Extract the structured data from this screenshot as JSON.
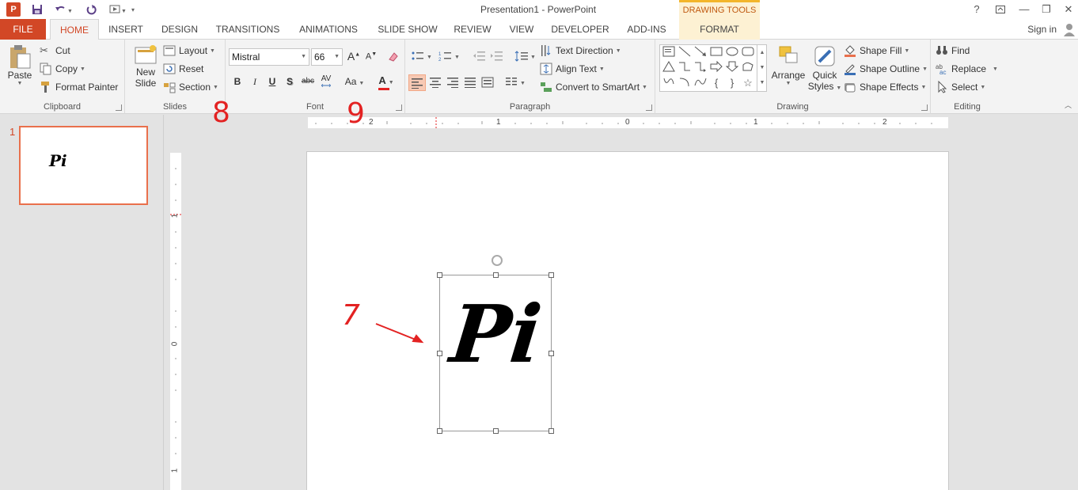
{
  "window": {
    "title": "Presentation1 - PowerPoint",
    "contextual_header": "DRAWING TOOLS",
    "help": "?",
    "minimize": "—",
    "restore": "❐",
    "close": "✕"
  },
  "tabs": {
    "file": "FILE",
    "items": [
      "HOME",
      "INSERT",
      "DESIGN",
      "TRANSITIONS",
      "ANIMATIONS",
      "SLIDE SHOW",
      "REVIEW",
      "VIEW",
      "DEVELOPER",
      "ADD-INS"
    ],
    "format": "FORMAT",
    "signin": "Sign in"
  },
  "clipboard": {
    "paste": "Paste",
    "cut": "Cut",
    "copy": "Copy",
    "format_painter": "Format Painter",
    "label": "Clipboard"
  },
  "slides": {
    "new_slide_1": "New",
    "new_slide_2": "Slide",
    "layout": "Layout",
    "reset": "Reset",
    "section": "Section",
    "label": "Slides"
  },
  "font": {
    "name": "Mistral",
    "size": "66",
    "bold": "B",
    "italic": "I",
    "underline": "U",
    "shadow": "S",
    "strike": "abc",
    "spacing": "AV",
    "case": "Aa",
    "color_letter": "A",
    "grow": "A",
    "shrink": "A",
    "label": "Font"
  },
  "paragraph": {
    "text_direction": "Text Direction",
    "align_text": "Align Text",
    "convert_smartart": "Convert to SmartArt",
    "label": "Paragraph"
  },
  "drawing": {
    "arrange": "Arrange",
    "quick_styles_1": "Quick",
    "quick_styles_2": "Styles",
    "shape_fill": "Shape Fill",
    "shape_outline": "Shape Outline",
    "shape_effects": "Shape Effects",
    "label": "Drawing"
  },
  "editing": {
    "find": "Find",
    "replace": "Replace",
    "select": "Select",
    "label": "Editing"
  },
  "ruler": {
    "h": [
      "2",
      "1",
      "0",
      "1",
      "2"
    ],
    "v": [
      "1",
      "0",
      "1"
    ]
  },
  "thumbnail": {
    "number": "1",
    "text": "Pi"
  },
  "slide": {
    "text": "Pi"
  },
  "annotations": {
    "seven": "7",
    "eight": "8",
    "nine": "9"
  },
  "colors": {
    "accent": "#d24726",
    "contextual": "#fdf1d3",
    "annotation": "#e32222"
  }
}
